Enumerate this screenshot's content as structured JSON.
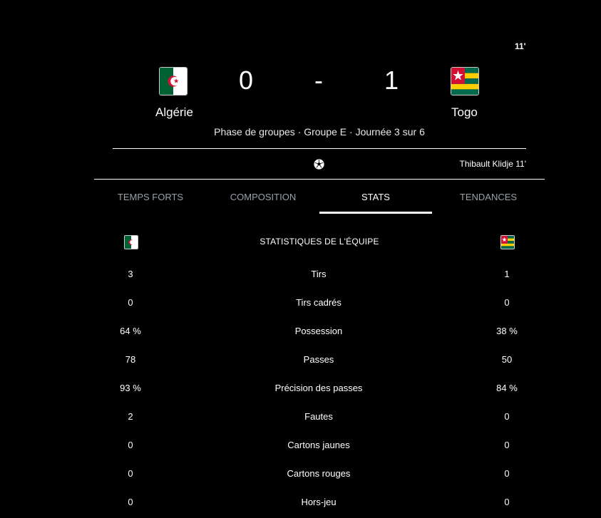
{
  "match": {
    "minute": "11'",
    "home": {
      "name": "Algérie",
      "score": "0"
    },
    "away": {
      "name": "Togo",
      "score": "1"
    },
    "separator": "-",
    "phase": "Phase de groupes · Groupe E · Journée 3 sur 6"
  },
  "event": {
    "icon": "soccer-ball-icon",
    "text": "Thibault Klidje 11'"
  },
  "tabs": [
    {
      "label": "TEMPS FORTS"
    },
    {
      "label": "COMPOSITION"
    },
    {
      "label": "STATS",
      "active": true
    },
    {
      "label": "TENDANCES"
    }
  ],
  "stats": {
    "title": "STATISTIQUES DE L'ÉQUIPE",
    "rows": [
      {
        "label": "Tirs",
        "home": "3",
        "away": "1"
      },
      {
        "label": "Tirs cadrés",
        "home": "0",
        "away": "0"
      },
      {
        "label": "Possession",
        "home": "64 %",
        "away": "38 %"
      },
      {
        "label": "Passes",
        "home": "78",
        "away": "50"
      },
      {
        "label": "Précision des passes",
        "home": "93 %",
        "away": "84 %"
      },
      {
        "label": "Fautes",
        "home": "2",
        "away": "0"
      },
      {
        "label": "Cartons jaunes",
        "home": "0",
        "away": "0"
      },
      {
        "label": "Cartons rouges",
        "home": "0",
        "away": "0"
      },
      {
        "label": "Hors-jeu",
        "home": "0",
        "away": "0"
      }
    ]
  },
  "colors": {
    "background": "#000000",
    "tab_inactive": "#9aa0a6",
    "algeria_green": "#006233",
    "algeria_red": "#d21034",
    "togo_green": "#006a4e",
    "togo_yellow": "#ffce00",
    "togo_red": "#d21034"
  }
}
